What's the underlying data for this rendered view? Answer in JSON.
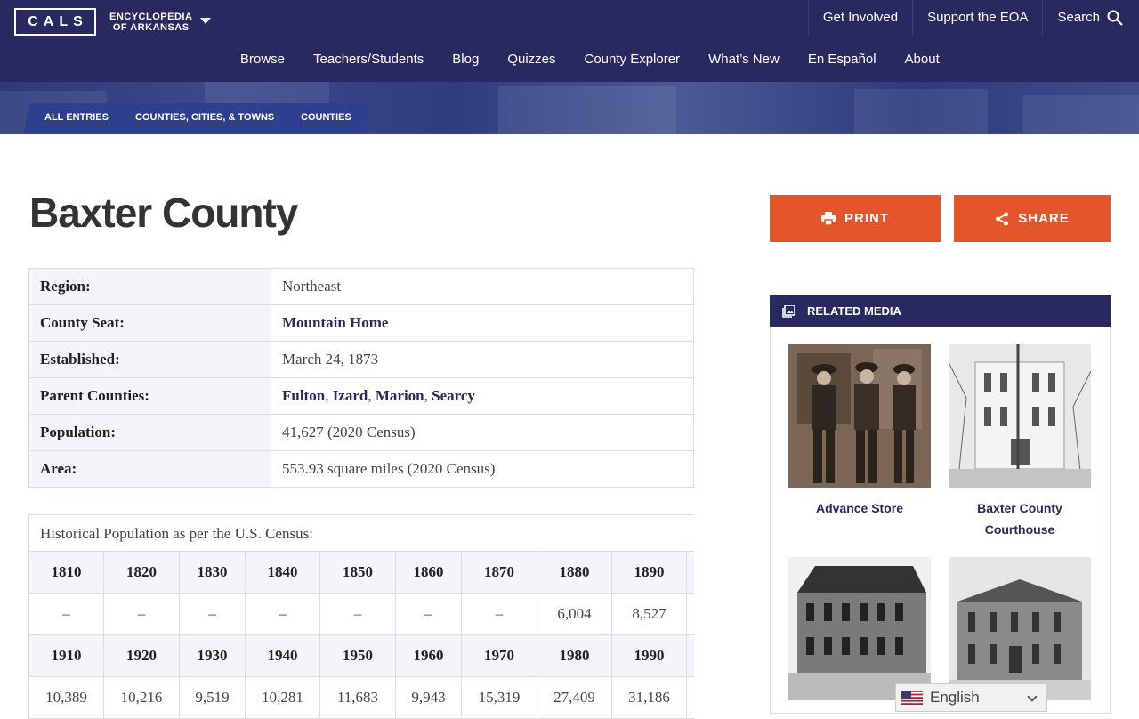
{
  "header": {
    "logo": "CALS",
    "site_name_line1": "ENCYCLOPEDIA",
    "site_name_line2": "OF ARKANSAS",
    "utility_nav": [
      "Get Involved",
      "Support the EOA",
      "Search"
    ],
    "main_nav": [
      "Browse",
      "Teachers/Students",
      "Blog",
      "Quizzes",
      "County Explorer",
      "What’s New",
      "En Español",
      "About"
    ]
  },
  "breadcrumbs": [
    "ALL ENTRIES",
    "COUNTIES, CITIES, & TOWNS",
    "COUNTIES"
  ],
  "page": {
    "title": "Baxter County",
    "facts": {
      "region_label": "Region:",
      "region_value": "Northeast",
      "seat_label": "County Seat:",
      "seat_value": "Mountain Home",
      "established_label": "Established:",
      "established_value": "March 24, 1873",
      "parents_label": "Parent Counties:",
      "parents": [
        "Fulton",
        "Izard",
        "Marion",
        "Searcy"
      ],
      "population_label": "Population:",
      "population_value": "41,627 (2020 Census)",
      "area_label": "Area:",
      "area_value": "553.93 square miles (2020 Census)"
    },
    "historical": {
      "caption": "Historical Population as per the U.S. Census:",
      "rows": [
        {
          "years": [
            "1810",
            "1820",
            "1830",
            "1840",
            "1850",
            "1860",
            "1870",
            "1880",
            "1890"
          ],
          "values": [
            "–",
            "–",
            "–",
            "–",
            "–",
            "–",
            "–",
            "6,004",
            "8,527"
          ]
        },
        {
          "years": [
            "1910",
            "1920",
            "1930",
            "1940",
            "1950",
            "1960",
            "1970",
            "1980",
            "1990"
          ],
          "values": [
            "10,389",
            "10,216",
            "9,519",
            "10,281",
            "11,683",
            "9,943",
            "15,319",
            "27,409",
            "31,186"
          ]
        }
      ]
    }
  },
  "actions": {
    "print_label": "PRINT",
    "share_label": "SHARE"
  },
  "related_media": {
    "heading": "RELATED MEDIA",
    "items": [
      {
        "caption": "Advance Store"
      },
      {
        "caption": "Baxter County Courthouse"
      },
      {
        "caption": ""
      },
      {
        "caption": ""
      }
    ]
  },
  "language": {
    "selected": "English"
  },
  "colors": {
    "navy": "#27295f",
    "accent": "#e4552b",
    "breadcrumb": "#2e3f8f"
  }
}
